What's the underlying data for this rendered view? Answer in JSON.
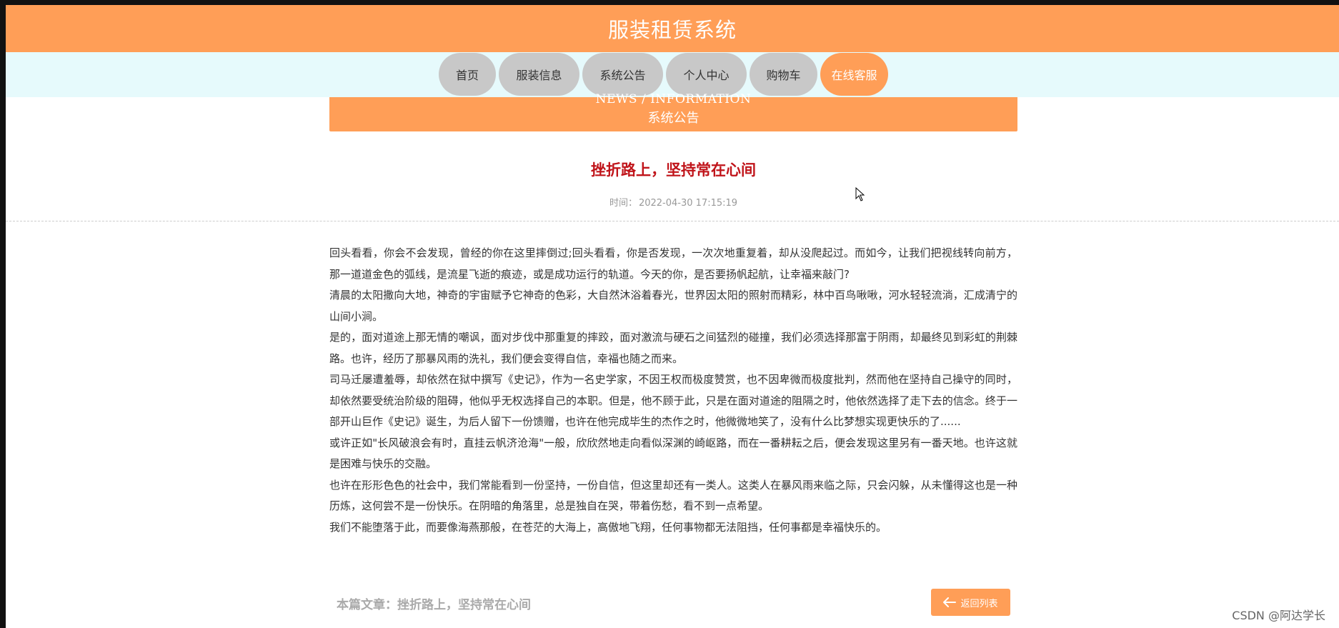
{
  "header": {
    "title": "服装租赁系统"
  },
  "nav": {
    "items": [
      {
        "label": "首页"
      },
      {
        "label": "服装信息"
      },
      {
        "label": "系统公告"
      },
      {
        "label": "个人中心"
      },
      {
        "label": "购物车"
      },
      {
        "label": "在线客服"
      }
    ],
    "active_index": 5
  },
  "section": {
    "title_en": "NEWS / INFORMATION",
    "title_cn": "系统公告"
  },
  "article": {
    "title": "挫折路上，坚持常在心间",
    "time_label": "时间：",
    "time_value": "2022-04-30 17:15:19",
    "paragraphs": [
      "回头看看，你会不会发现，曾经的你在这里摔倒过;回头看看，你是否发现，一次次地重复着，却从没爬起过。而如今，让我们把视线转向前方，那一道道金色的弧线，是流星飞逝的痕迹，或是成功运行的轨道。今天的你，是否要扬帆起航，让幸福来敲门?",
      "清晨的太阳撒向大地，神奇的宇宙赋予它神奇的色彩，大自然沐浴着春光，世界因太阳的照射而精彩，林中百鸟啾啾，河水轻轻流淌，汇成清宁的山间小涧。",
      "是的，面对道途上那无情的嘲讽，面对步伐中那重复的摔跤，面对激流与硬石之间猛烈的碰撞，我们必须选择那富于阴雨，却最终见到彩虹的荆棘路。也许，经历了那暴风雨的洗礼，我们便会变得自信，幸福也随之而来。",
      "司马迁屡遭羞辱，却依然在狱中撰写《史记》，作为一名史学家，不因王权而极度赞赏，也不因卑微而极度批判，然而他在坚持自己操守的同时，却依然要受统治阶级的阻碍，他似乎无权选择自己的本职。但是，他不顾于此，只是在面对道途的阻隔之时，他依然选择了走下去的信念。终于一部开山巨作《史记》诞生，为后人留下一份馈赠，也许在他完成毕生的杰作之时，他微微地笑了，没有什么比梦想实现更快乐的了......",
      "或许正如\"长风破浪会有时，直挂云帆济沧海\"一般，欣欣然地走向看似深渊的崎岖路，而在一番耕耘之后，便会发现这里另有一番天地。也许这就是困难与快乐的交融。",
      "也许在形形色色的社会中，我们常能看到一份坚持，一份自信，但这里却还有一类人。这类人在暴风雨来临之际，只会闪躲，从未懂得这也是一种历炼，这何尝不是一份快乐。在阴暗的角落里，总是独自在哭，带着伤愁，看不到一点希望。",
      "我们不能堕落于此，而要像海燕那般，在苍茫的大海上，高傲地飞翔，任何事物都无法阻挡，任何事都是幸福快乐的。"
    ]
  },
  "footer": {
    "current_article": "本篇文章：挫折路上，坚持常在心间",
    "back_label": "返回列表"
  },
  "watermark": "CSDN @阿达学长",
  "colors": {
    "accent": "#ff9e57",
    "nav_inactive": "#c8c8c8",
    "title_red": "#c0141a",
    "nav_band": "#e6fafc"
  },
  "icons": {
    "back": "arrow-left-icon",
    "cursor": "mouse-pointer-icon"
  }
}
